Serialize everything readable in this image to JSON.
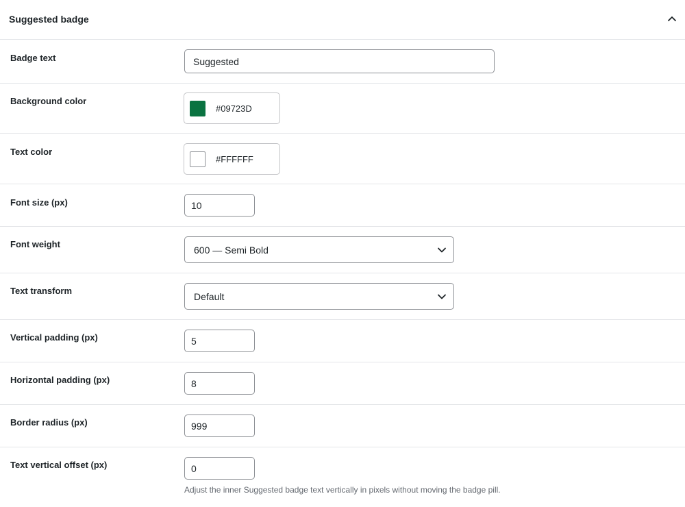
{
  "panel": {
    "title": "Suggested badge",
    "collapse_icon": "chevron-up-icon"
  },
  "fields": {
    "badge_text": {
      "label": "Badge text",
      "value": "Suggested"
    },
    "background_color": {
      "label": "Background color",
      "value": "#09723D",
      "swatch": "#0a7341"
    },
    "text_color": {
      "label": "Text color",
      "value": "#FFFFFF",
      "swatch": "#ffffff"
    },
    "font_size": {
      "label": "Font size (px)",
      "value": "10"
    },
    "font_weight": {
      "label": "Font weight",
      "value": "600 — Semi Bold",
      "icon": "chevron-down-icon"
    },
    "text_transform": {
      "label": "Text transform",
      "value": "Default",
      "icon": "chevron-down-icon"
    },
    "vertical_padding": {
      "label": "Vertical padding (px)",
      "value": "5"
    },
    "horizontal_padding": {
      "label": "Horizontal padding (px)",
      "value": "8"
    },
    "border_radius": {
      "label": "Border radius (px)",
      "value": "999"
    },
    "text_vertical_offset": {
      "label": "Text vertical offset (px)",
      "value": "0",
      "help": "Adjust the inner Suggested badge text vertically in pixels without moving the badge pill."
    }
  }
}
